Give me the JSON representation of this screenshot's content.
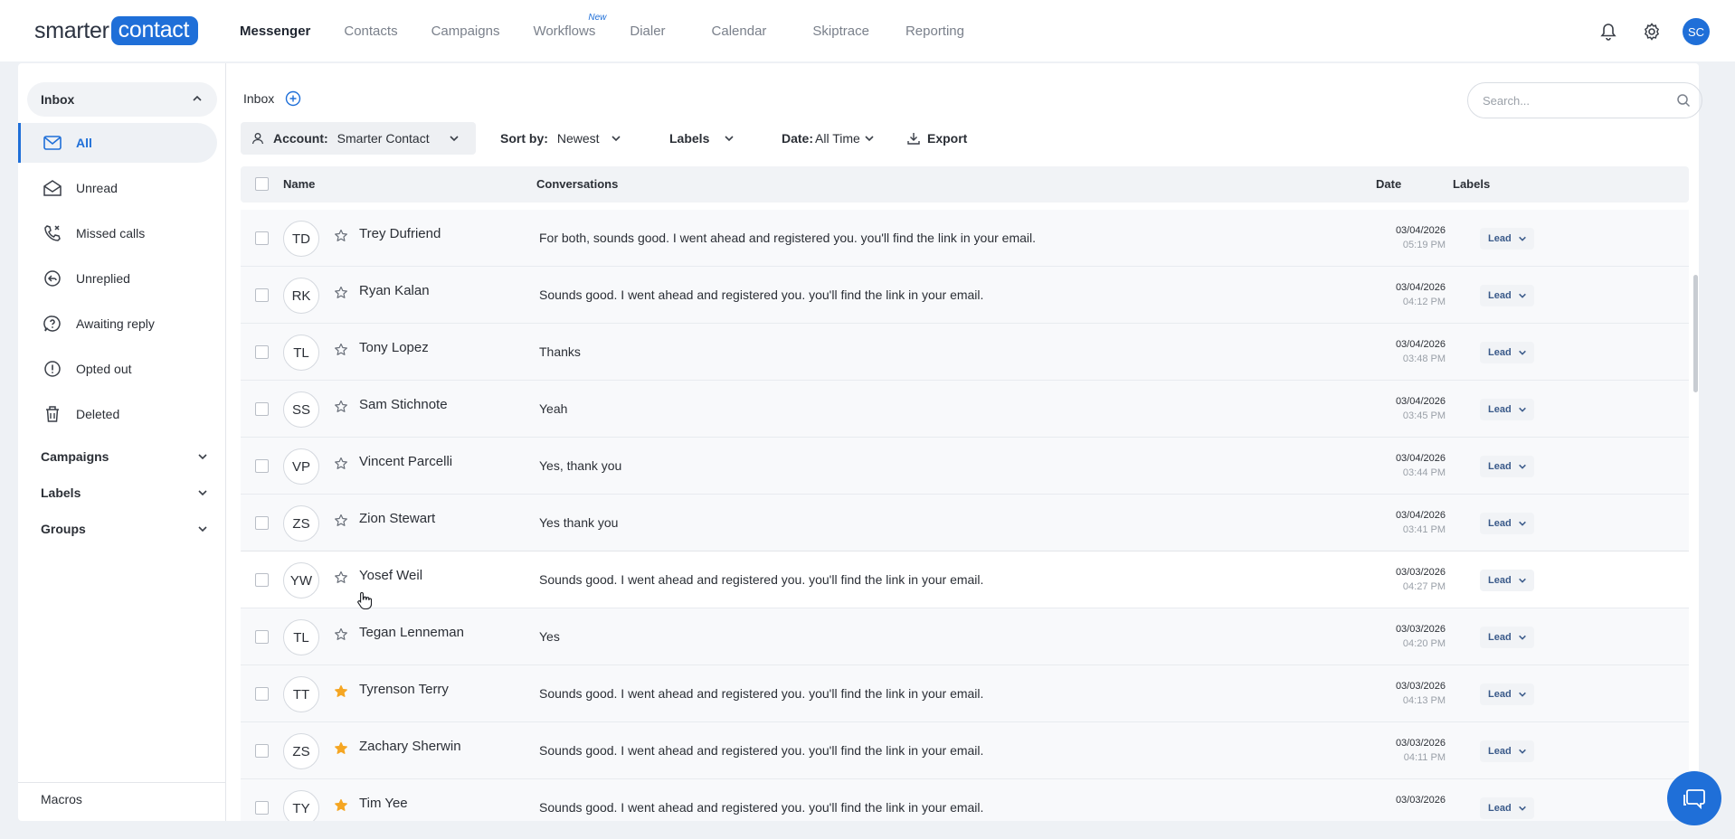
{
  "logo": {
    "part1": "smarter",
    "part2": "contact"
  },
  "nav": {
    "items": [
      {
        "label": "Messenger",
        "active": true
      },
      {
        "label": "Contacts"
      },
      {
        "label": "Campaigns"
      },
      {
        "label": "Workflows",
        "badge": "New"
      },
      {
        "label": "Dialer"
      },
      {
        "label": "Calendar"
      },
      {
        "label": "Skiptrace"
      },
      {
        "label": "Reporting"
      }
    ],
    "avatar_initials": "SC"
  },
  "sidebar": {
    "inbox_label": "Inbox",
    "items": [
      {
        "label": "All",
        "icon": "mail-icon",
        "active": true
      },
      {
        "label": "Unread",
        "icon": "mail-open-icon"
      },
      {
        "label": "Missed calls",
        "icon": "missed-call-icon"
      },
      {
        "label": "Unreplied",
        "icon": "reply-icon"
      },
      {
        "label": "Awaiting reply",
        "icon": "question-icon"
      },
      {
        "label": "Opted out",
        "icon": "alert-icon"
      },
      {
        "label": "Deleted",
        "icon": "trash-icon"
      }
    ],
    "sections": [
      "Campaigns",
      "Labels",
      "Groups"
    ],
    "macros_label": "Macros"
  },
  "content": {
    "title": "Inbox",
    "search_placeholder": "Search...",
    "filters": {
      "account_label": "Account:",
      "account_value": "Smarter Contact",
      "sort_label": "Sort by:",
      "sort_value": "Newest",
      "labels_label": "Labels",
      "date_label": "Date:",
      "date_value": "All Time",
      "export_label": "Export"
    },
    "table": {
      "headers": {
        "name": "Name",
        "conversations": "Conversations",
        "date": "Date",
        "labels": "Labels"
      },
      "rows": [
        {
          "initials": "TD",
          "name": "Trey Dufriend",
          "starred": false,
          "message": "For both, sounds good. I went ahead and registered you. you'll find the link in your email.",
          "date": "03/04/2026",
          "time": "05:19 PM",
          "label": "Lead"
        },
        {
          "initials": "RK",
          "name": "Ryan Kalan",
          "starred": false,
          "message": "Sounds good. I went ahead and registered you. you'll find the link in your email.",
          "date": "03/04/2026",
          "time": "04:12 PM",
          "label": "Lead"
        },
        {
          "initials": "TL",
          "name": "Tony Lopez",
          "starred": false,
          "message": "Thanks",
          "date": "03/04/2026",
          "time": "03:48 PM",
          "label": "Lead"
        },
        {
          "initials": "SS",
          "name": "Sam Stichnote",
          "starred": false,
          "message": "Yeah",
          "date": "03/04/2026",
          "time": "03:45 PM",
          "label": "Lead"
        },
        {
          "initials": "VP",
          "name": "Vincent Parcelli",
          "starred": false,
          "message": "Yes, thank you",
          "date": "03/04/2026",
          "time": "03:44 PM",
          "label": "Lead"
        },
        {
          "initials": "ZS",
          "name": "Zion Stewart",
          "starred": false,
          "message": "Yes thank you",
          "date": "03/04/2026",
          "time": "03:41 PM",
          "label": "Lead"
        },
        {
          "initials": "YW",
          "name": "Yosef Weil",
          "starred": false,
          "message": "Sounds good. I went ahead and registered you. you'll find the link in your email.",
          "date": "03/03/2026",
          "time": "04:27 PM",
          "label": "Lead",
          "hover": true
        },
        {
          "initials": "TL",
          "name": "Tegan Lenneman",
          "starred": false,
          "message": "Yes",
          "date": "03/03/2026",
          "time": "04:20 PM",
          "label": "Lead"
        },
        {
          "initials": "TT",
          "name": "Tyrenson Terry",
          "starred": true,
          "message": "Sounds good. I went ahead and registered you. you'll find the link in your email.",
          "date": "03/03/2026",
          "time": "04:13 PM",
          "label": "Lead"
        },
        {
          "initials": "ZS",
          "name": "Zachary Sherwin",
          "starred": true,
          "message": "Sounds good. I went ahead and registered you. you'll find the link in your email.",
          "date": "03/03/2026",
          "time": "04:11 PM",
          "label": "Lead"
        },
        {
          "initials": "TY",
          "name": "Tim Yee",
          "starred": true,
          "message": "Sounds good. I went ahead and registered you. you'll find the link in your email.",
          "date": "03/03/2026",
          "time": "",
          "label": "Lead"
        }
      ]
    }
  },
  "colors": {
    "brand": "#1f6fd8",
    "star": "#f5a623",
    "label_text": "#3a5a8a"
  }
}
